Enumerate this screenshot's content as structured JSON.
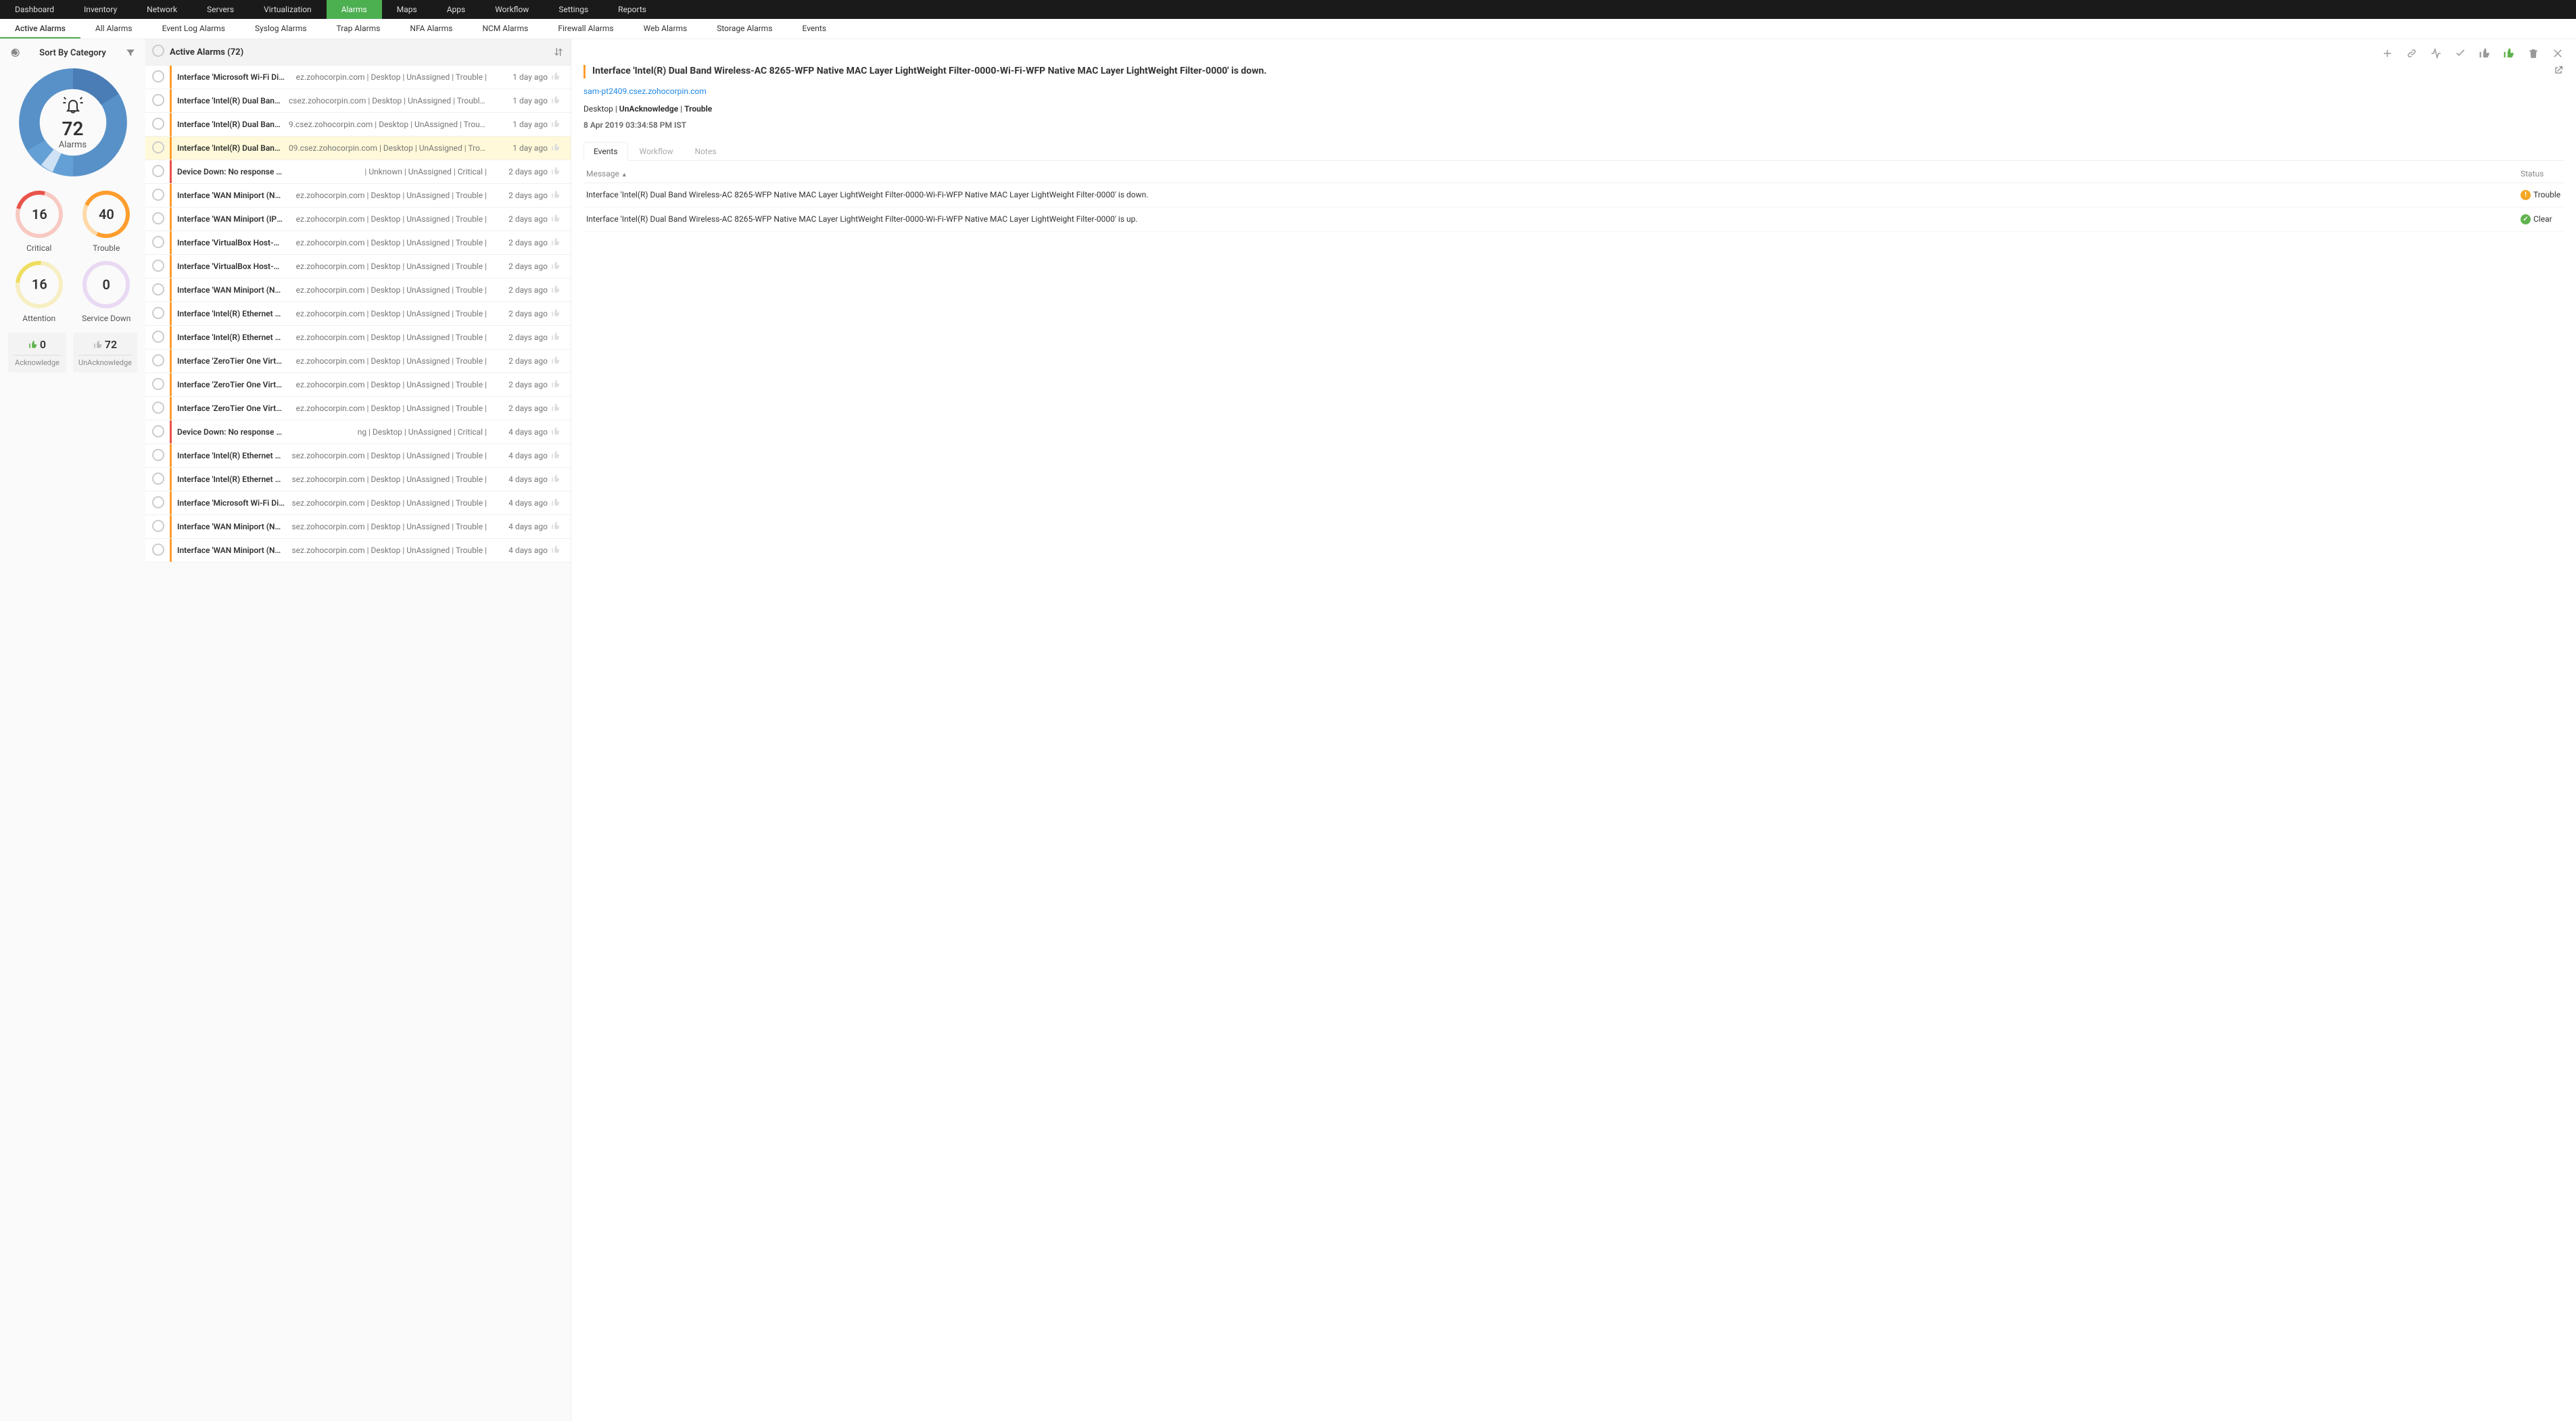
{
  "topnav": [
    "Dashboard",
    "Inventory",
    "Network",
    "Servers",
    "Virtualization",
    "Alarms",
    "Maps",
    "Apps",
    "Workflow",
    "Settings",
    "Reports"
  ],
  "topnav_active": 5,
  "subnav": [
    "Active Alarms",
    "All Alarms",
    "Event Log Alarms",
    "Syslog Alarms",
    "Trap Alarms",
    "NFA Alarms",
    "NCM Alarms",
    "Firewall Alarms",
    "Web Alarms",
    "Storage Alarms",
    "Events"
  ],
  "subnav_active": 0,
  "sidebar": {
    "sort_title": "Sort By Category",
    "alarm_count": "72",
    "alarm_label": "Alarms",
    "gauges": [
      {
        "value": "16",
        "label": "Critical",
        "cls": "red"
      },
      {
        "value": "40",
        "label": "Trouble",
        "cls": "orange"
      },
      {
        "value": "16",
        "label": "Attention",
        "cls": "yellow"
      },
      {
        "value": "0",
        "label": "Service Down",
        "cls": "purple"
      }
    ],
    "ack": {
      "n": "0",
      "l": "Acknowledge",
      "thumb": "green"
    },
    "unack": {
      "n": "72",
      "l": "UnAcknowledge",
      "thumb": "grey"
    }
  },
  "list_title": "Active Alarms (72)",
  "alarms": [
    {
      "sev": "orange",
      "msg": "Interface 'Microsoft Wi-Fi Dire...",
      "meta": "ez.zohocorpin.com | Desktop | UnAssigned | Trouble |",
      "age": "1 day ago"
    },
    {
      "sev": "orange",
      "msg": "Interface 'Intel(R) Dual Band ...",
      "meta": "csez.zohocorpin.com | Desktop | UnAssigned | Trouble |",
      "age": "1 day ago"
    },
    {
      "sev": "orange",
      "msg": "Interface 'Intel(R) Dual Band ...",
      "meta": "9.csez.zohocorpin.com | Desktop | UnAssigned | Trouble |",
      "age": "1 day ago"
    },
    {
      "sev": "orange",
      "msg": "Interface 'Intel(R) Dual Band ...",
      "meta": "09.csez.zohocorpin.com | Desktop | UnAssigned | Trouble |",
      "age": "1 day ago",
      "sel": true
    },
    {
      "sev": "red",
      "msg": "Device Down: No response fro...",
      "meta": "| Unknown | UnAssigned | Critical |",
      "age": "2 days ago"
    },
    {
      "sev": "orange",
      "msg": "Interface 'WAN Miniport (Net...",
      "meta": "ez.zohocorpin.com | Desktop | UnAssigned | Trouble |",
      "age": "2 days ago"
    },
    {
      "sev": "orange",
      "msg": "Interface 'WAN Miniport (IPv6...",
      "meta": "ez.zohocorpin.com | Desktop | UnAssigned | Trouble |",
      "age": "2 days ago"
    },
    {
      "sev": "orange",
      "msg": "Interface 'VirtualBox Host-Onl...",
      "meta": "ez.zohocorpin.com | Desktop | UnAssigned | Trouble |",
      "age": "2 days ago"
    },
    {
      "sev": "orange",
      "msg": "Interface 'VirtualBox Host-Onl...",
      "meta": "ez.zohocorpin.com | Desktop | UnAssigned | Trouble |",
      "age": "2 days ago"
    },
    {
      "sev": "orange",
      "msg": "Interface 'WAN Miniport (Net...",
      "meta": "ez.zohocorpin.com | Desktop | UnAssigned | Trouble |",
      "age": "2 days ago"
    },
    {
      "sev": "orange",
      "msg": "Interface 'Intel(R) Ethernet Co...",
      "meta": "ez.zohocorpin.com | Desktop | UnAssigned | Trouble |",
      "age": "2 days ago"
    },
    {
      "sev": "orange",
      "msg": "Interface 'Intel(R) Ethernet Co...",
      "meta": "ez.zohocorpin.com | Desktop | UnAssigned | Trouble |",
      "age": "2 days ago"
    },
    {
      "sev": "orange",
      "msg": "Interface 'ZeroTier One Virtua...",
      "meta": "ez.zohocorpin.com | Desktop | UnAssigned | Trouble |",
      "age": "2 days ago"
    },
    {
      "sev": "orange",
      "msg": "Interface 'ZeroTier One Virtua...",
      "meta": "ez.zohocorpin.com | Desktop | UnAssigned | Trouble |",
      "age": "2 days ago"
    },
    {
      "sev": "orange",
      "msg": "Interface 'ZeroTier One Virtua...",
      "meta": "ez.zohocorpin.com | Desktop | UnAssigned | Trouble |",
      "age": "2 days ago"
    },
    {
      "sev": "red",
      "msg": "Device Down: No response fro...",
      "meta": "ng | Desktop | UnAssigned | Critical |",
      "age": "4 days ago"
    },
    {
      "sev": "orange",
      "msg": "Interface 'Intel(R) Ethernet Co...",
      "meta": "sez.zohocorpin.com | Desktop | UnAssigned | Trouble |",
      "age": "4 days ago"
    },
    {
      "sev": "orange",
      "msg": "Interface 'Intel(R) Ethernet Co...",
      "meta": "sez.zohocorpin.com | Desktop | UnAssigned | Trouble |",
      "age": "4 days ago"
    },
    {
      "sev": "orange",
      "msg": "Interface 'Microsoft Wi-Fi Dire...",
      "meta": "sez.zohocorpin.com | Desktop | UnAssigned | Trouble |",
      "age": "4 days ago"
    },
    {
      "sev": "orange",
      "msg": "Interface 'WAN Miniport (Net...",
      "meta": "sez.zohocorpin.com | Desktop | UnAssigned | Trouble |",
      "age": "4 days ago"
    },
    {
      "sev": "orange",
      "msg": "Interface 'WAN Miniport (Net...",
      "meta": "sez.zohocorpin.com | Desktop | UnAssigned | Trouble |",
      "age": "4 days ago"
    }
  ],
  "detail": {
    "title": "Interface 'Intel(R) Dual Band Wireless-AC 8265-WFP Native MAC Layer LightWeight Filter-0000-Wi-Fi-WFP Native MAC Layer LightWeight Filter-0000' is down.",
    "source": "sam-pt2409.csez.zohocorpin.com",
    "meta_html": "Desktop | <b>UnAcknowledge</b> | <b>Trouble</b>",
    "time": "8 Apr 2019 03:34:58 PM IST",
    "tabs": [
      "Events",
      "Workflow",
      "Notes"
    ],
    "tab_active": 0,
    "columns": {
      "msg": "Message",
      "status": "Status"
    },
    "events": [
      {
        "msg": "Interface 'Intel(R) Dual Band Wireless-AC 8265-WFP Native MAC Layer LightWeight Filter-0000-Wi-Fi-WFP Native MAC Layer LightWeight Filter-0000' is down.",
        "status": "Trouble",
        "badge": "trouble",
        "glyph": "!"
      },
      {
        "msg": "Interface 'Intel(R) Dual Band Wireless-AC 8265-WFP Native MAC Layer LightWeight Filter-0000-Wi-Fi-WFP Native MAC Layer LightWeight Filter-0000' is up.",
        "status": "Clear",
        "badge": "clear",
        "glyph": "✓"
      }
    ]
  },
  "chart_data": {
    "type": "pie",
    "title": "Alarms by Category",
    "total": 72,
    "series": [
      {
        "name": "Trouble",
        "value": 40,
        "color": "#5891c8"
      },
      {
        "name": "Critical",
        "value": 16,
        "color": "#4a7db5"
      },
      {
        "name": "Attention",
        "value": 16,
        "color": "#64a0d6"
      },
      {
        "name": "Service Down",
        "value": 0,
        "color": "#cfe2f3"
      }
    ]
  }
}
